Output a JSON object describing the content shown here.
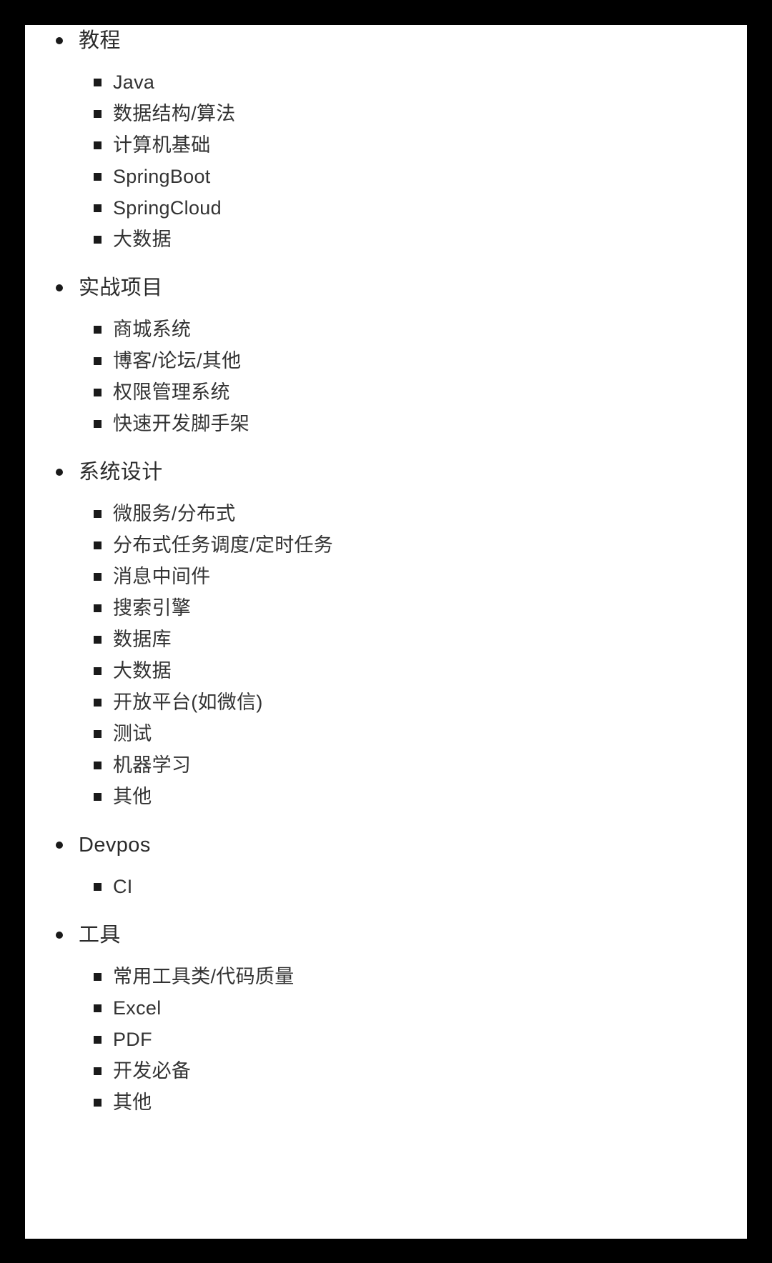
{
  "document": {
    "type": "outline-list",
    "background_color": "#000000",
    "card_color": "#ffffff",
    "text_color": "#333333",
    "bullet_color": "#1a1a1a"
  },
  "outline": {
    "groups": [
      {
        "label": "教程",
        "bullet": "disc",
        "items": [
          {
            "label": "Java",
            "bullet": "square"
          },
          {
            "label": "数据结构/算法",
            "bullet": "square"
          },
          {
            "label": "计算机基础",
            "bullet": "square"
          },
          {
            "label": "SpringBoot",
            "bullet": "square"
          },
          {
            "label": "SpringCloud",
            "bullet": "square"
          },
          {
            "label": "大数据",
            "bullet": "square"
          }
        ]
      },
      {
        "label": "实战项目",
        "bullet": "disc",
        "items": [
          {
            "label": "商城系统",
            "bullet": "square"
          },
          {
            "label": "博客/论坛/其他",
            "bullet": "square"
          },
          {
            "label": "权限管理系统",
            "bullet": "square"
          },
          {
            "label": "快速开发脚手架",
            "bullet": "square"
          }
        ]
      },
      {
        "label": "系统设计",
        "bullet": "disc",
        "items": [
          {
            "label": "微服务/分布式",
            "bullet": "square"
          },
          {
            "label": "分布式任务调度/定时任务",
            "bullet": "square"
          },
          {
            "label": "消息中间件",
            "bullet": "square"
          },
          {
            "label": "搜索引擎",
            "bullet": "square"
          },
          {
            "label": "数据库",
            "bullet": "square"
          },
          {
            "label": "大数据",
            "bullet": "square"
          },
          {
            "label": "开放平台(如微信)",
            "bullet": "square"
          },
          {
            "label": "测试",
            "bullet": "square"
          },
          {
            "label": "机器学习",
            "bullet": "square"
          },
          {
            "label": "其他",
            "bullet": "square"
          }
        ]
      },
      {
        "label": "Devpos",
        "bullet": "disc",
        "items": [
          {
            "label": "CI",
            "bullet": "square"
          }
        ]
      },
      {
        "label": "工具",
        "bullet": "disc",
        "items": [
          {
            "label": "常用工具类/代码质量",
            "bullet": "square"
          },
          {
            "label": "Excel",
            "bullet": "square"
          },
          {
            "label": "PDF",
            "bullet": "square"
          },
          {
            "label": "开发必备",
            "bullet": "square"
          },
          {
            "label": "其他",
            "bullet": "square"
          }
        ]
      }
    ]
  }
}
